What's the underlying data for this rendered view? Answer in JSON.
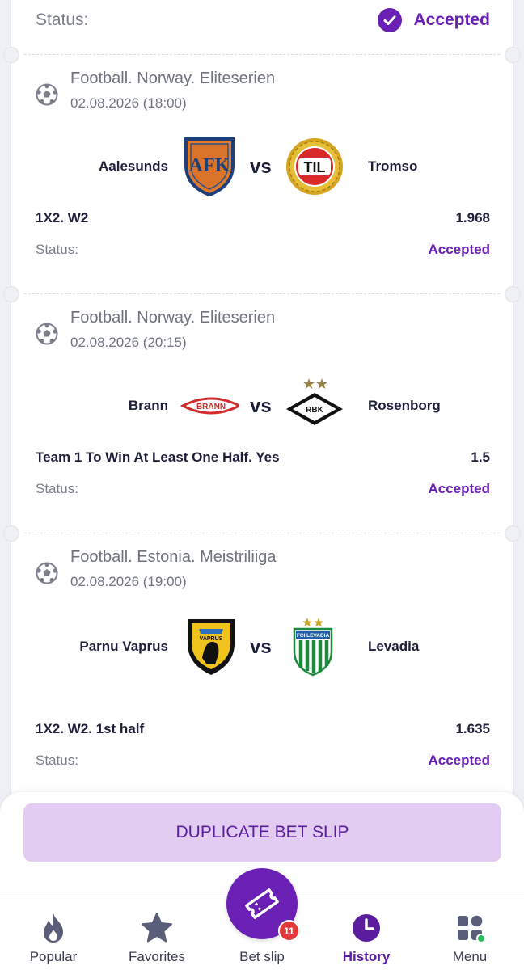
{
  "top_status": {
    "label": "Status:",
    "value": "Accepted"
  },
  "events": [
    {
      "league": "Football. Norway. Eliteserien",
      "datetime": "02.08.2026 (18:00)",
      "team1": "Aalesunds",
      "team2": "Tromso",
      "team1_logo_text": "AFK",
      "team2_logo_text": "TIL",
      "vs": "vs",
      "bet": "1X2. W2",
      "odds": "1.968",
      "status_label": "Status:",
      "status_value": "Accepted"
    },
    {
      "league": "Football. Norway. Eliteserien",
      "datetime": "02.08.2026 (20:15)",
      "team1": "Brann",
      "team2": "Rosenborg",
      "team1_logo_text": "BRANN",
      "team2_logo_text": "RBK",
      "vs": "vs",
      "bet": "Team 1 To Win At Least One Half. Yes",
      "odds": "1.5",
      "status_label": "Status:",
      "status_value": "Accepted"
    },
    {
      "league": "Football. Estonia. Meistriliiga",
      "datetime": "02.08.2026 (19:00)",
      "team1": "Parnu Vaprus",
      "team2": "Levadia",
      "team1_logo_text": "VAPRUS",
      "team2_logo_text": "FCI LEVADIA",
      "vs": "vs",
      "bet": "1X2. W2. 1st half",
      "odds": "1.635",
      "status_label": "Status:",
      "status_value": "Accepted"
    }
  ],
  "actions": {
    "duplicate_label": "DUPLICATE BET SLIP"
  },
  "nav": {
    "items": [
      {
        "label": "Popular",
        "icon": "flame-icon"
      },
      {
        "label": "Favorites",
        "icon": "star-icon"
      },
      {
        "label": "Bet slip",
        "icon": "ticket-icon",
        "badge": "11"
      },
      {
        "label": "History",
        "icon": "clock-icon",
        "active": true
      },
      {
        "label": "Menu",
        "icon": "grid-icon"
      }
    ]
  },
  "colors": {
    "accent": "#6a1fb5",
    "button_bg": "#e2ccf2",
    "badge": "#e03a3a",
    "background": "#eef0f5"
  }
}
